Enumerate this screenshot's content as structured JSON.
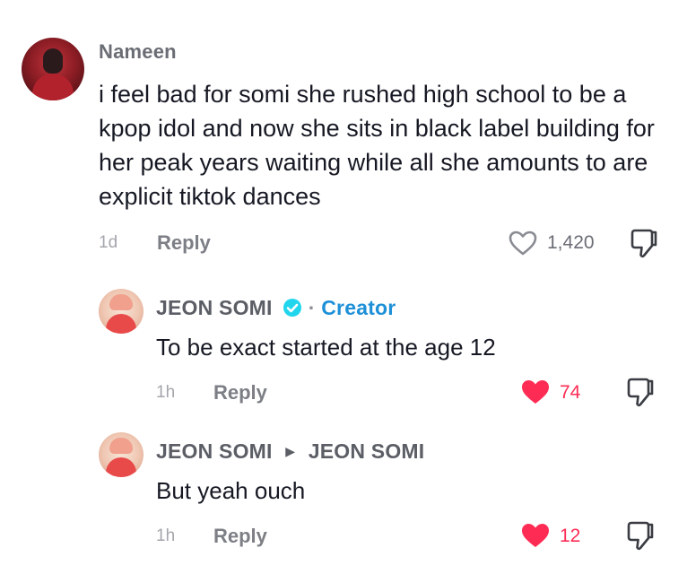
{
  "comments": [
    {
      "username": "Nameen",
      "text": "i feel bad for somi she rushed high school to be a kpop idol and now she sits in black label building for her peak years waiting while all she amounts to are explicit tiktok dances",
      "time": "1d",
      "reply_label": "Reply",
      "likes": "1,420",
      "liked": false
    },
    {
      "username": "JEON SOMI",
      "verified": true,
      "dot": "·",
      "creator_label": "Creator",
      "text": "To be exact started at the age 12",
      "time": "1h",
      "reply_label": "Reply",
      "likes": "74",
      "liked": true
    },
    {
      "username": "JEON SOMI",
      "reply_to": "JEON SOMI",
      "text": "But yeah ouch",
      "time": "1h",
      "reply_label": "Reply",
      "likes": "12",
      "liked": true
    }
  ],
  "colors": {
    "like_active": "#fe2c55",
    "creator": "#1e90d8",
    "text": "#161823",
    "muted": "#a4a6ac"
  },
  "icons": {
    "like": "heart-icon",
    "dislike": "thumbs-down-icon",
    "verified": "verified-badge-icon",
    "reply_arrow": "triangle-right-icon"
  }
}
